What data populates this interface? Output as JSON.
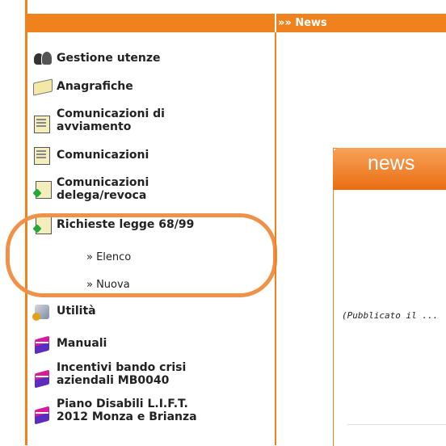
{
  "header": {
    "news_label": "»» News"
  },
  "sidebar": {
    "items": [
      {
        "label_line1": "Gestione utenze",
        "label_line2": "",
        "icon": "users-icon"
      },
      {
        "label_line1": "Anagrafiche",
        "label_line2": "",
        "icon": "registry-book-icon"
      },
      {
        "label_line1": "Comunicazioni di",
        "label_line2": "avviamento",
        "icon": "document-icon"
      },
      {
        "label_line1": "Comunicazioni",
        "label_line2": "",
        "icon": "document-icon"
      },
      {
        "label_line1": "Comunicazioni",
        "label_line2": "delega/revoca",
        "icon": "document-green-icon"
      },
      {
        "label_line1": "Richieste legge 68/99",
        "label_line2": "",
        "icon": "document-green-icon"
      },
      {
        "label_line1": "Utilità",
        "label_line2": "",
        "icon": "tools-icon"
      },
      {
        "label_line1": "Manuali",
        "label_line2": "",
        "icon": "books-icon"
      },
      {
        "label_line1": "Incentivi bando crisi",
        "label_line2": "aziendali MB0040",
        "icon": "books-icon"
      },
      {
        "label_line1": "Piano Disabili L.I.F.T.",
        "label_line2": "2012 Monza e Brianza",
        "icon": "books-icon"
      }
    ],
    "subitems": [
      {
        "label": "» Elenco"
      },
      {
        "label": "» Nuova"
      }
    ]
  },
  "panel": {
    "title": "news",
    "published": "(Pubblicato il ..."
  },
  "colors": {
    "accent": "#f0821e",
    "highlight": "#f0914a"
  }
}
